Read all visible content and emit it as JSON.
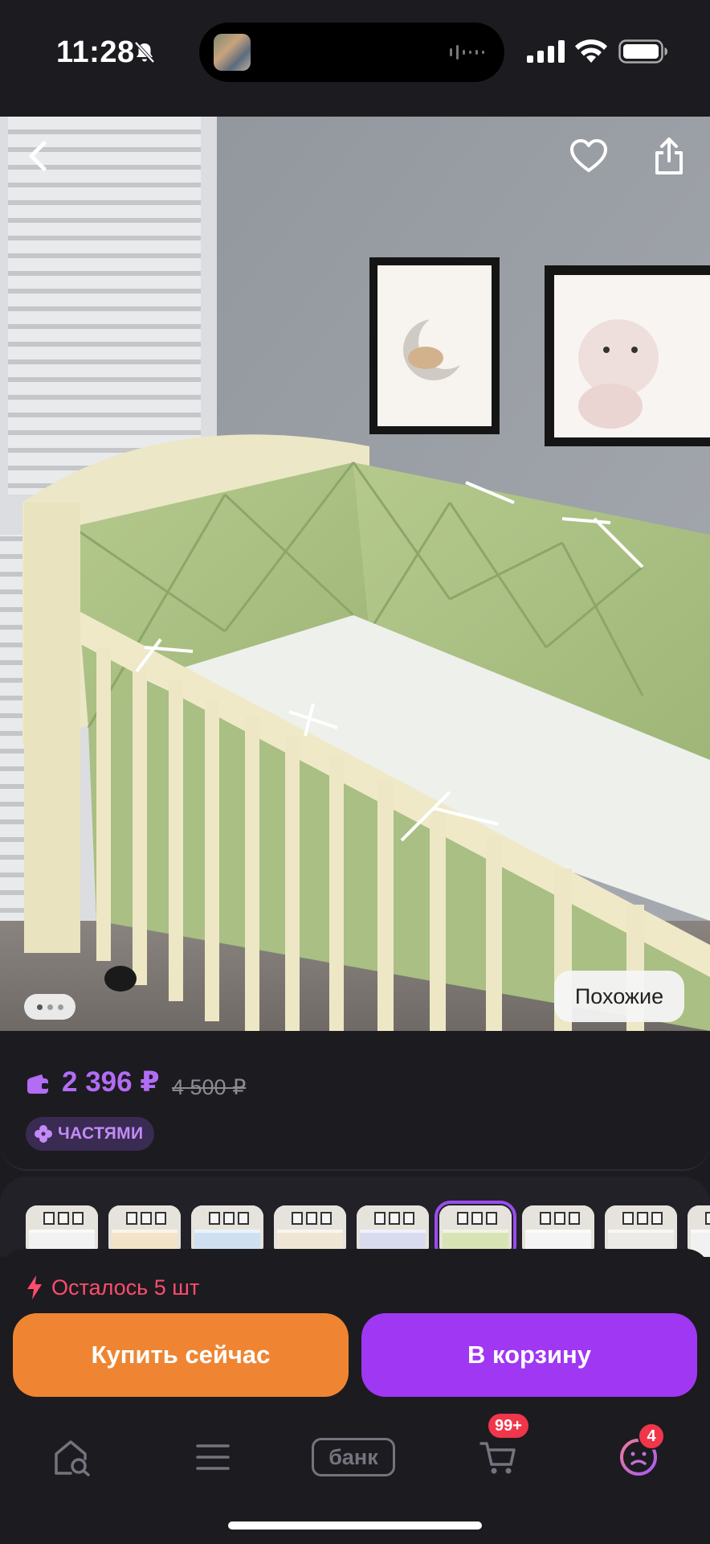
{
  "status_bar": {
    "time": "11:28",
    "icons": [
      "bell-slash-icon",
      "signal-icon",
      "wifi-icon",
      "battery-icon"
    ]
  },
  "hero": {
    "icons": [
      "back-arrow-icon",
      "heart-icon",
      "share-icon"
    ],
    "similar_label": "Похожие",
    "gallery_dots": 3
  },
  "product": {
    "price": "2 396 ₽",
    "old_price": "4 500 ₽",
    "installments_label": "ЧАСТЯМИ",
    "icons": [
      "wallet-icon",
      "clover-icon"
    ]
  },
  "variants": {
    "count": 9,
    "selected_index": 5,
    "colors": [
      "#f2f2f2",
      "#f3e3c9",
      "#cfe0f0",
      "#efe6d6",
      "#d9dcef",
      "#d9e4b5",
      "#f4f4f4",
      "#ecebe8",
      "#f1f1f1"
    ]
  },
  "stock": {
    "text": "Осталось 5 шт",
    "icon": "lightning-icon",
    "color": "#ff4d6d"
  },
  "actions": {
    "buy_now": "Купить сейчас",
    "to_cart": "В корзину",
    "buy_color": "#ef8532",
    "cart_color": "#a037f2"
  },
  "nav": {
    "bank_label": "банк",
    "cart_badge": "99+",
    "profile_badge": "4",
    "icons": [
      "home-search-icon",
      "catalog-icon",
      "bank-icon",
      "cart-icon",
      "profile-icon"
    ]
  }
}
